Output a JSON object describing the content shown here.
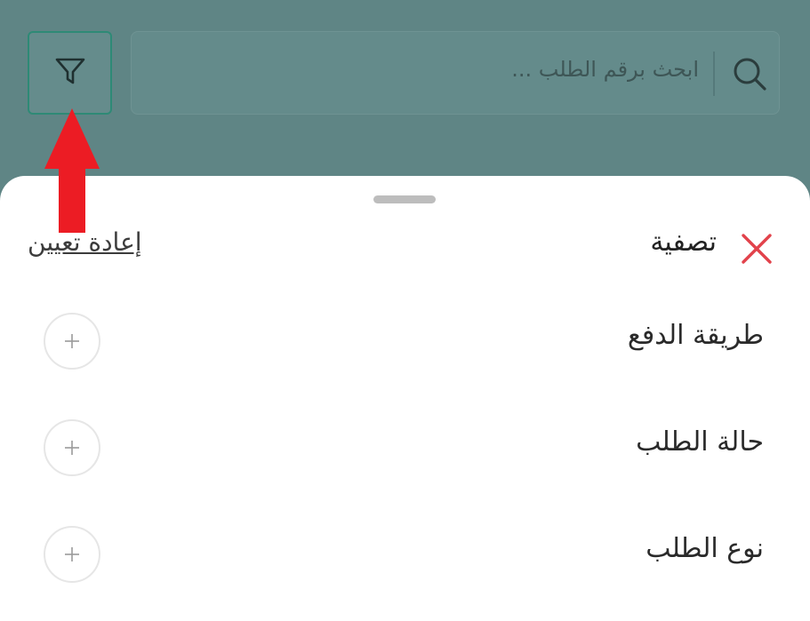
{
  "search": {
    "placeholder": "ابحث برقم الطلب ..."
  },
  "sheet": {
    "title": "تصفية",
    "reset_label": "إعادة تعيين",
    "filters": [
      {
        "label": "طريقة الدفع"
      },
      {
        "label": "حالة الطلب"
      },
      {
        "label": "نوع الطلب"
      }
    ]
  },
  "icons": {
    "filter": "filter-funnel-icon",
    "search": "search-icon",
    "close": "close-x-icon",
    "add": "plus-icon",
    "annotation": "red-up-arrow"
  },
  "colors": {
    "overlay": "#5f8585",
    "accent_border": "#2e8a76",
    "close_red": "#e2424b",
    "arrow_red": "#ec1c24"
  }
}
